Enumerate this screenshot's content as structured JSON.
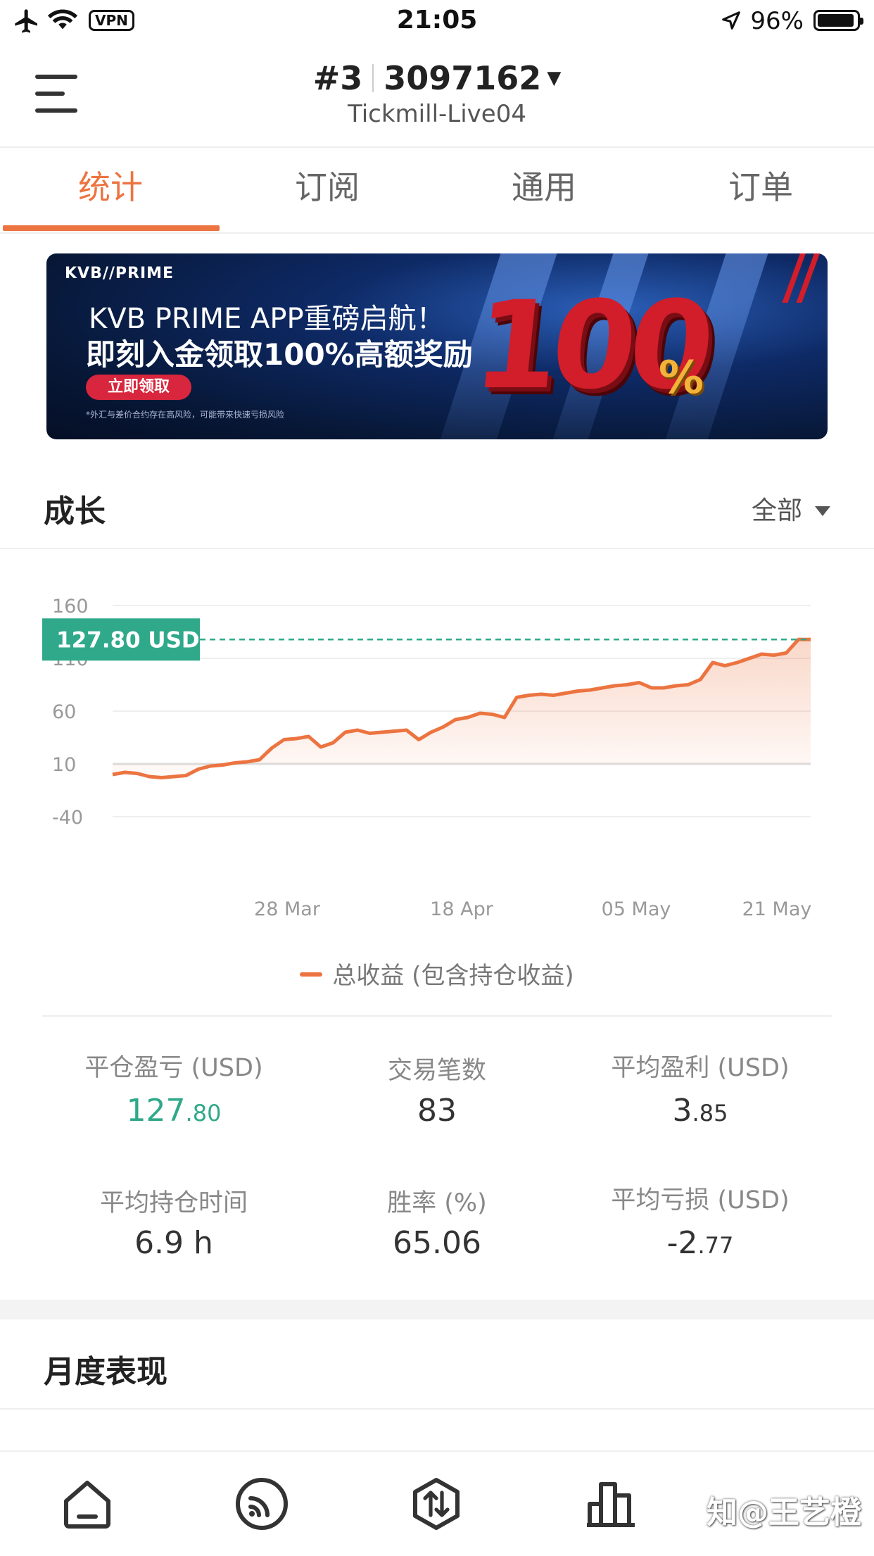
{
  "status_bar": {
    "time": "21:05",
    "vpn": "VPN",
    "battery": "96%"
  },
  "header": {
    "account_prefix": "#3",
    "account_number": "3097162",
    "server": "Tickmill-Live04"
  },
  "tabs": [
    {
      "label": "统计",
      "active": true
    },
    {
      "label": "订阅",
      "active": false
    },
    {
      "label": "通用",
      "active": false
    },
    {
      "label": "订单",
      "active": false
    }
  ],
  "banner": {
    "brand": "KVB//PRIME",
    "headline1": "KVB PRIME APP重磅启航！",
    "headline2": "即刻入金领取100%高额奖励",
    "cta": "立即领取",
    "disclaimer": "*外汇与差价合约存在高风险，可能带来快速亏损风险",
    "big_number": "100",
    "percent": "%"
  },
  "growth": {
    "title": "成长",
    "filter": "全部"
  },
  "chart_data": {
    "type": "area",
    "current_label": "127.80 USD",
    "legend": "总收益 (包含持仓收益)",
    "ylim": [
      -40,
      160
    ],
    "yticks": [
      "160",
      "110",
      "60",
      "10",
      "-40"
    ],
    "xticks": [
      "28 Mar",
      "18 Apr",
      "05 May",
      "21 May"
    ],
    "color": "#ec7440",
    "label_color": "#2fa989",
    "values": [
      0,
      2,
      1,
      -2,
      -3,
      -2,
      -1,
      5,
      8,
      9,
      11,
      12,
      14,
      25,
      33,
      34,
      36,
      26,
      30,
      40,
      42,
      39,
      40,
      41,
      42,
      33,
      40,
      45,
      52,
      54,
      58,
      57,
      54,
      73,
      75,
      76,
      75,
      77,
      79,
      80,
      82,
      84,
      85,
      87,
      82,
      82,
      84,
      85,
      90,
      106,
      103,
      106,
      110,
      114,
      113,
      115,
      127.8,
      127.8
    ]
  },
  "stats": [
    {
      "label": "平仓盈亏 (USD)",
      "int": "127",
      "dec": ".80",
      "green": true
    },
    {
      "label": "交易笔数",
      "int": "83",
      "dec": "",
      "green": false
    },
    {
      "label": "平均盈利 (USD)",
      "int": "3",
      "dec": ".85",
      "green": false
    },
    {
      "label": "平均持仓时间",
      "int": "6.9 h",
      "dec": "",
      "green": false
    },
    {
      "label": "胜率 (%)",
      "int": "65.06",
      "dec": "",
      "green": false
    },
    {
      "label": "平均亏损 (USD)",
      "int": "-2",
      "dec": ".77",
      "green": false
    }
  ],
  "monthly": {
    "title": "月度表现"
  },
  "bottom_nav": [
    "home-icon",
    "rss-icon",
    "trade-icon",
    "chart-icon"
  ],
  "watermark": "知@王艺橙"
}
